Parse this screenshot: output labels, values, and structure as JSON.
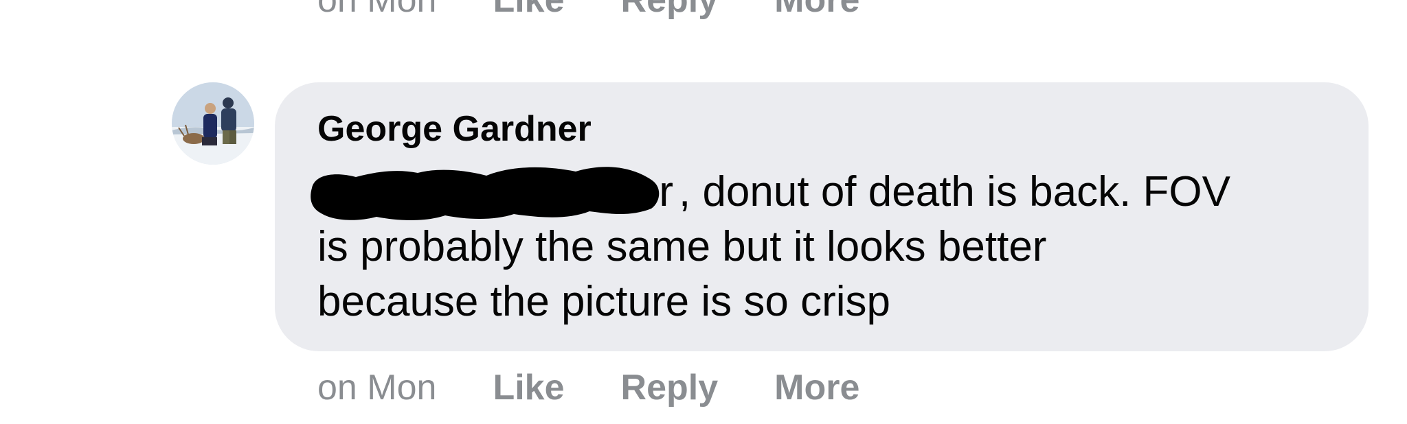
{
  "previous_comment": {
    "timestamp": "on Mon",
    "like_label": "Like",
    "reply_label": "Reply",
    "more_label": "More"
  },
  "comment": {
    "author": "George Gardner",
    "mention_visible_suffix": "r",
    "text_line1": ", donut of death is back. FOV",
    "text_line2": "is probably the same but it looks better",
    "text_line3": "because the picture is so crisp",
    "timestamp": "on Mon",
    "like_label": "Like",
    "reply_label": "Reply",
    "more_label": "More"
  },
  "colors": {
    "bubble_bg": "#ebecf0",
    "text_primary": "#050505",
    "text_secondary": "#8a8d91",
    "redaction": "#000000"
  },
  "icons": {
    "avatar": "profile-photo"
  }
}
